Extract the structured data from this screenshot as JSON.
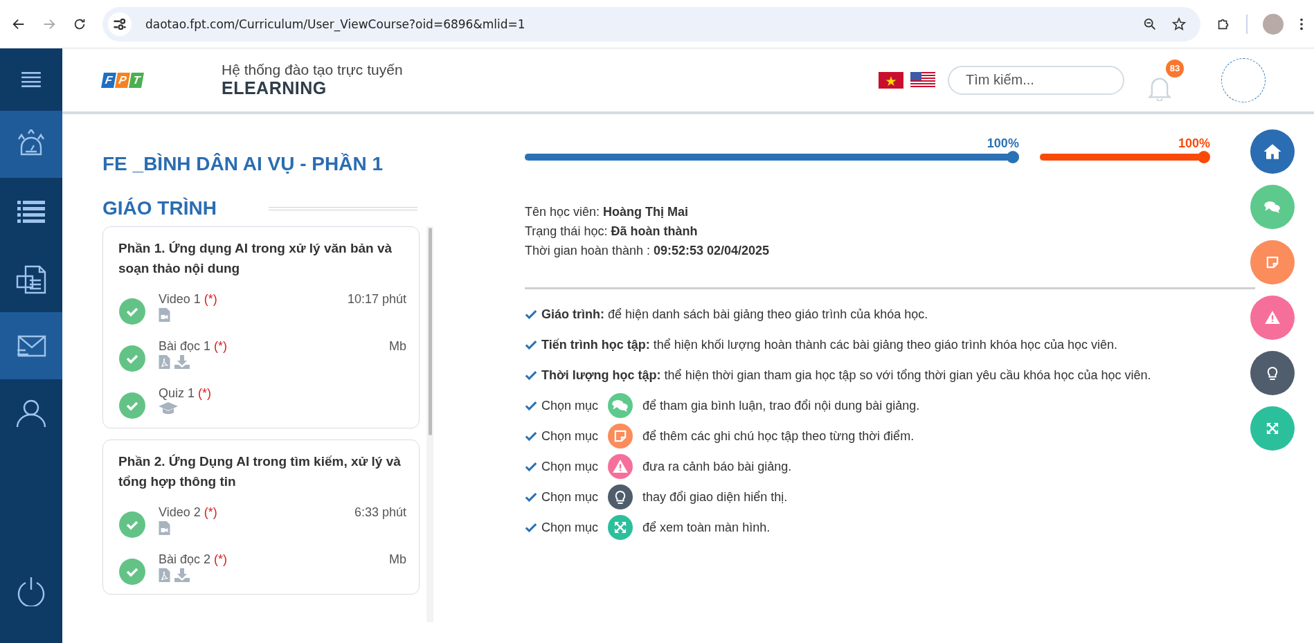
{
  "browser": {
    "url": "daotao.fpt.com/Curriculum/User_ViewCourse?oid=6896&mlid=1"
  },
  "sidebar": {
    "items": [
      {
        "kind": "dashboard",
        "selected": true
      },
      {
        "kind": "list",
        "selected": false
      },
      {
        "kind": "document",
        "selected": false
      },
      {
        "kind": "mail",
        "selected": true
      },
      {
        "kind": "user",
        "selected": false
      }
    ]
  },
  "header": {
    "logo": [
      "F",
      "P",
      "T"
    ],
    "subtitle": "Hệ thống đào tạo trực tuyến",
    "title": "ELEARNING",
    "search": {
      "placeholder": "Tìm kiếm..."
    },
    "notifications": "83"
  },
  "course": {
    "title": "FE _BÌNH DÂN AI VỤ - PHẦN 1",
    "curriculum_heading": "GIÁO TRÌNH",
    "sections": [
      {
        "title": "Phần 1. Ứng dụng AI trong xử lý văn bản và soạn thảo nội dung",
        "lessons": [
          {
            "kind": "video",
            "name": "Video 1",
            "required": "(*)",
            "meta": "10:17 phút",
            "completed": true
          },
          {
            "kind": "reading",
            "name": "Bài đọc 1",
            "required": "(*)",
            "meta": "Mb",
            "completed": true
          },
          {
            "kind": "quiz",
            "name": "Quiz 1",
            "required": "(*)",
            "completed": true
          }
        ]
      },
      {
        "title": "Phần 2. Ứng Dụng AI trong tìm kiếm, xử lý và tổng hợp thông tin",
        "lessons": [
          {
            "kind": "video",
            "name": "Video 2",
            "required": "(*)",
            "meta": "6:33 phút",
            "completed": true
          },
          {
            "kind": "reading",
            "name": "Bài đọc 2",
            "required": "(*)",
            "meta": "Mb",
            "completed": true
          }
        ]
      }
    ]
  },
  "progress": [
    {
      "level": 1,
      "reading": "100%",
      "color": "#2a72b5"
    },
    {
      "level": 1,
      "reading": "100%",
      "color": "#fa4a0a"
    }
  ],
  "student": [
    {
      "label": "Tên học viên:",
      "value": "Hoàng Thị Mai"
    },
    {
      "label": "Trạng thái học:",
      "value": "Đã hoàn thành"
    },
    {
      "label": "Thời gian hoàn thành :",
      "value": "09:52:53 02/04/2025"
    }
  ],
  "legend": [
    {
      "kind": "term",
      "term": "Giáo trình:",
      "text": "để hiện danh sách bài giảng theo giáo trình của khóa học."
    },
    {
      "kind": "term",
      "term": "Tiến trình học tập:",
      "text": "thể hiện khối lượng hoàn thành các bài giảng theo giáo trình khóa học của học viên."
    },
    {
      "kind": "term",
      "term": "Thời lượng học tập:",
      "text": "thể hiện thời gian tham gia học tập so với tổng thời gian yêu cầu khóa học của học viên."
    },
    {
      "kind": "chat",
      "term": "Chọn mục",
      "color": "#5ec98c",
      "text": "để tham gia bình luận, trao đổi nội dung bài giảng."
    },
    {
      "kind": "note",
      "term": "Chọn mục",
      "color": "#fb8c5c",
      "text": "để thêm các ghi chú học tập theo từng thời điểm."
    },
    {
      "kind": "warning",
      "term": "Chọn mục",
      "color": "#f66f9b",
      "text": "đưa ra cảnh báo bài giảng."
    },
    {
      "kind": "idea",
      "term": "Chọn mục",
      "color": "#4f5d6c",
      "text": "thay đổi giao diện hiển thị."
    },
    {
      "kind": "fullscreen",
      "term": "Chọn mục",
      "color": "#2cbf9c",
      "text": "để xem toàn màn hình."
    }
  ],
  "actions": [
    {
      "kind": "home",
      "color": "#2a6db2"
    },
    {
      "kind": "chat",
      "color": "#5ec98c"
    },
    {
      "kind": "note",
      "color": "#fb8c5c"
    },
    {
      "kind": "warning",
      "color": "#f66f9b"
    },
    {
      "kind": "idea",
      "color": "#4f5d6c"
    },
    {
      "kind": "fullscreen",
      "color": "#2cbf9c"
    }
  ]
}
